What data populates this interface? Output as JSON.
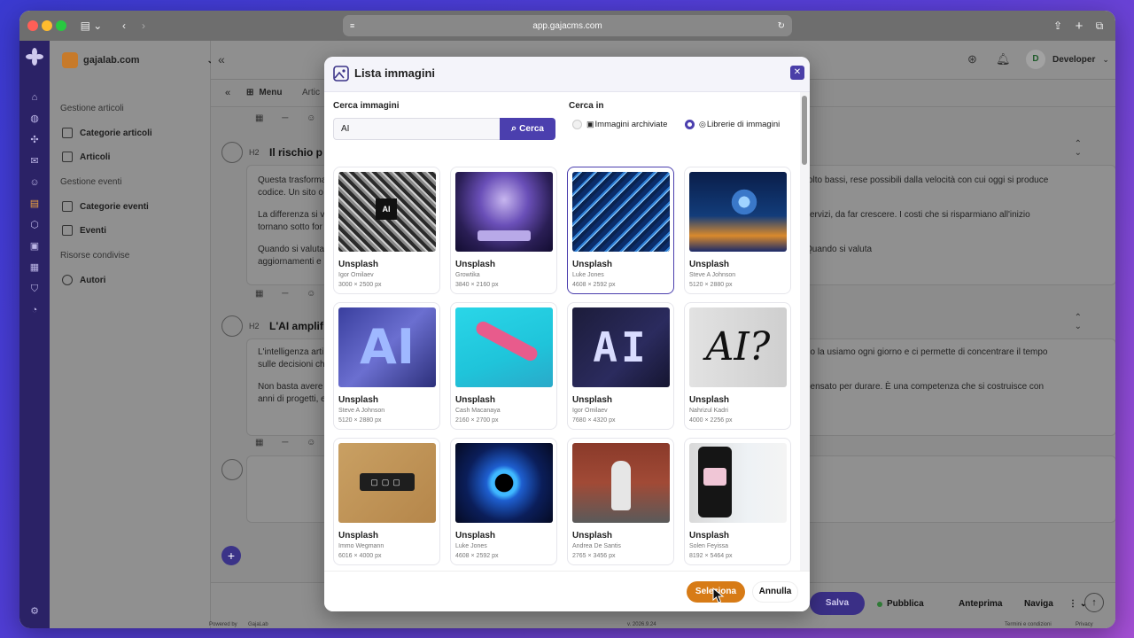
{
  "browser": {
    "url": "app.gajacms.com"
  },
  "sidebar": {
    "org": "gajalab.com",
    "section1": "Gestione articoli",
    "items1": [
      "Categorie articoli",
      "Articoli"
    ],
    "section2": "Gestione eventi",
    "items2": [
      "Categorie eventi",
      "Eventi"
    ],
    "section3": "Risorse condivise",
    "items3": [
      "Autori"
    ]
  },
  "topbar": {
    "user_initial": "D",
    "user": "Developer"
  },
  "subbar": {
    "menu": "Menu",
    "crumb": "Artic"
  },
  "editor": {
    "h2_tag": "H2",
    "heading1": "Il rischio p",
    "p1a": "Questa trasforma",
    "p1a_r": "olto bassi, rese possibili dalla velocità con cui oggi si produce",
    "p1b": "codice. Un sito o",
    "p2a": "La differenza si v",
    "p2a_r": "servizi, da far crescere. I costi che si risparmiano all'inizio",
    "p2b": "tornano sotto for",
    "p3a": "Quando si valuta",
    "p3a_r": "a della revisione del codice? Come vengono gestiti",
    "p3b": "aggiornamenti e",
    "heading2": "L'AI amplif",
    "p4a": "L'intelligenza arti",
    "p4a_r": "no la usiamo ogni giorno e ci permette di concentrare il tempo",
    "p4b": "sulle decisioni ch",
    "p5a": "Non basta avere",
    "p5a_r": "pensato per durare. È una competenza che si costruisce con",
    "p5b": "anni di progetti, e"
  },
  "footer": {
    "save": "Salva",
    "publish": "Pubblica",
    "preview": "Anteprima",
    "navigate": "Naviga",
    "more": "⋮ ⌄",
    "powered": "Powered by",
    "brand": "GajaLab",
    "version": "v. 2026.9.24",
    "terms": "Termini e condizioni",
    "privacy": "Privacy"
  },
  "modal": {
    "title": "Lista immagini",
    "search_label": "Cerca immagini",
    "search_value": "AI",
    "search_button": "Cerca",
    "search_in_label": "Cerca in",
    "option1": "Immagini archiviate",
    "option2": "Librerie di immagini",
    "selected_option": "Librerie di immagini",
    "select_button": "Seleziona",
    "cancel_button": "Annulla",
    "images": [
      {
        "title": "Unsplash",
        "author": "Igor Omilaev",
        "dims": "3000 × 2500 px",
        "selected": false
      },
      {
        "title": "Unsplash",
        "author": "Growtika",
        "dims": "3840 × 2160 px",
        "selected": false
      },
      {
        "title": "Unsplash",
        "author": "Luke Jones",
        "dims": "4608 × 2592 px",
        "selected": true
      },
      {
        "title": "Unsplash",
        "author": "Steve A Johnson",
        "dims": "5120 × 2880 px",
        "selected": false
      },
      {
        "title": "Unsplash",
        "author": "Steve A Johnson",
        "dims": "5120 × 2880 px",
        "selected": false
      },
      {
        "title": "Unsplash",
        "author": "Cash Macanaya",
        "dims": "2160 × 2700 px",
        "selected": false
      },
      {
        "title": "Unsplash",
        "author": "Igor Omilaev",
        "dims": "7680 × 4320 px",
        "selected": false
      },
      {
        "title": "Unsplash",
        "author": "Nahrizul Kadri",
        "dims": "4000 × 2256 px",
        "selected": false
      },
      {
        "title": "Unsplash",
        "author": "Immo Wegmann",
        "dims": "6016 × 4000 px",
        "selected": false
      },
      {
        "title": "Unsplash",
        "author": "Luke Jones",
        "dims": "4608 × 2592 px",
        "selected": false
      },
      {
        "title": "Unsplash",
        "author": "Andrea De Santis",
        "dims": "2765 × 3456 px",
        "selected": false
      },
      {
        "title": "Unsplash",
        "author": "Solen Feyissa",
        "dims": "8192 × 5464 px",
        "selected": false
      }
    ]
  },
  "colors": {
    "accent": "#4b3fae",
    "select_button": "#d77b16"
  }
}
